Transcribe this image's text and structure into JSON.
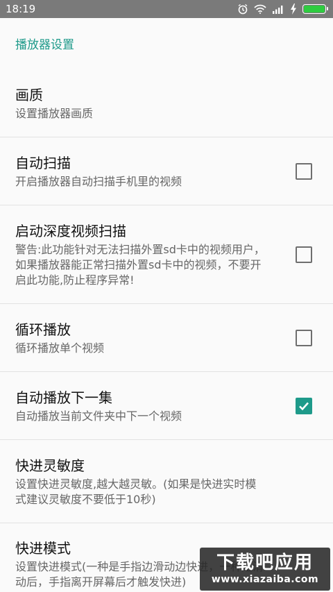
{
  "statusbar": {
    "time": "18:19",
    "icons": [
      "alarm-icon",
      "wifi-icon",
      "signal-icon",
      "charging-icon",
      "battery-icon"
    ],
    "battery_level": 1.0
  },
  "section": {
    "title": "播放器设置"
  },
  "settings": [
    {
      "title": "画质",
      "subtitle": "设置播放器画质",
      "checkbox": null
    },
    {
      "title": "自动扫描",
      "subtitle": "开启播放器自动扫描手机里的视频",
      "checkbox": false
    },
    {
      "title": "启动深度视频扫描",
      "subtitle": "警告:此功能针对无法扫描外置sd卡中的视频用户，如果播放器能正常扫描外置sd卡中的视频，不要开启此功能,防止程序异常!",
      "checkbox": false
    },
    {
      "title": "循环播放",
      "subtitle": "循环播放单个视频",
      "checkbox": false
    },
    {
      "title": "自动播放下一集",
      "subtitle": "自动播放当前文件夹中下一个视频",
      "checkbox": true
    },
    {
      "title": "快进灵敏度",
      "subtitle": "设置快进灵敏度,越大越灵敏。(如果是快进实时模式建议灵敏度不要低于10秒)",
      "checkbox": null
    },
    {
      "title": "快进模式",
      "subtitle": "设置快进模式(一种是手指边滑动边快进，一种是滑动后，手指离开屏幕后才触发快进)",
      "checkbox": null
    }
  ],
  "watermark": {
    "title": "下载吧应用",
    "url": "www.xiazaiba.com"
  },
  "colors": {
    "accent": "#1e9a8a",
    "statusbar": "#7a7a7a",
    "battery": "#2ecc40"
  }
}
